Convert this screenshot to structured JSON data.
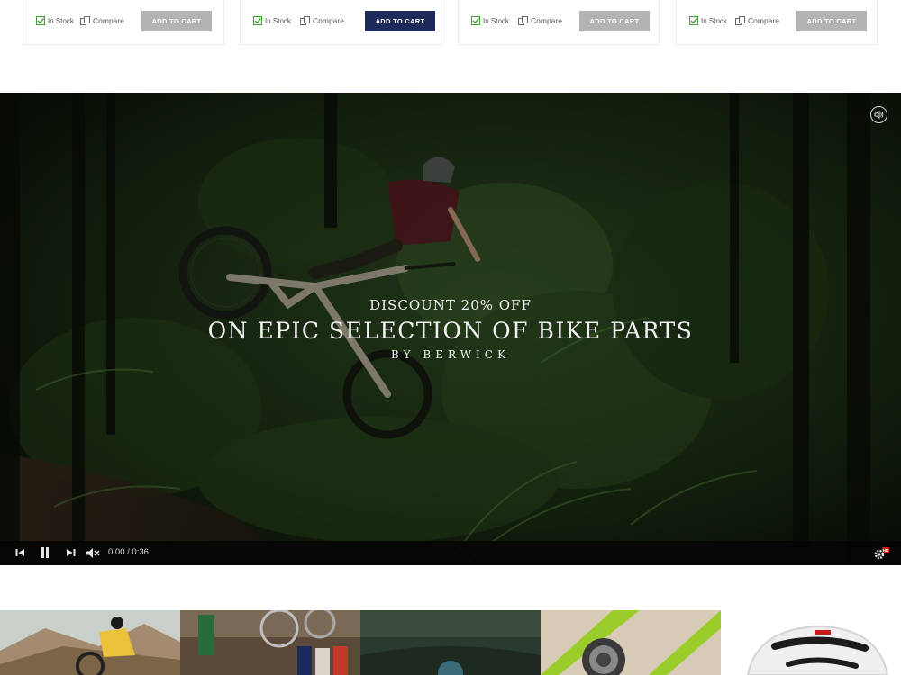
{
  "products": [
    {
      "stock_label": "In Stock",
      "compare_label": "Compare",
      "cart_label": "ADD TO CART",
      "cart_style": "gray"
    },
    {
      "stock_label": "In Stock",
      "compare_label": "Compare",
      "cart_label": "ADD TO CART",
      "cart_style": "navy"
    },
    {
      "stock_label": "In Stock",
      "compare_label": "Compare",
      "cart_label": "ADD TO CART",
      "cart_style": "gray"
    },
    {
      "stock_label": "In Stock",
      "compare_label": "Compare",
      "cart_label": "ADD TO CART",
      "cart_style": "gray"
    }
  ],
  "video": {
    "caption_line1": "DISCOUNT 20% OFF",
    "caption_line2": "ON EPIC SELECTION OF BIKE PARTS",
    "caption_line3": "BY BERWICK",
    "time_display": "0:00 / 0:36",
    "icons": [
      "mute-toggle-icon",
      "skip-back-icon",
      "pause-icon",
      "muted-speaker-icon",
      "settings-gear-hd-icon"
    ]
  },
  "gallery": {
    "thumbs": [
      "mountain-rider",
      "bike-shop",
      "dark-trail",
      "bike-cassette",
      "white-helmet"
    ]
  },
  "colors": {
    "navy_button": "#1d2a5a",
    "gray_button": "#b3b3b3",
    "stock_green": "#3aa02c",
    "hd_badge": "#d0201c"
  }
}
